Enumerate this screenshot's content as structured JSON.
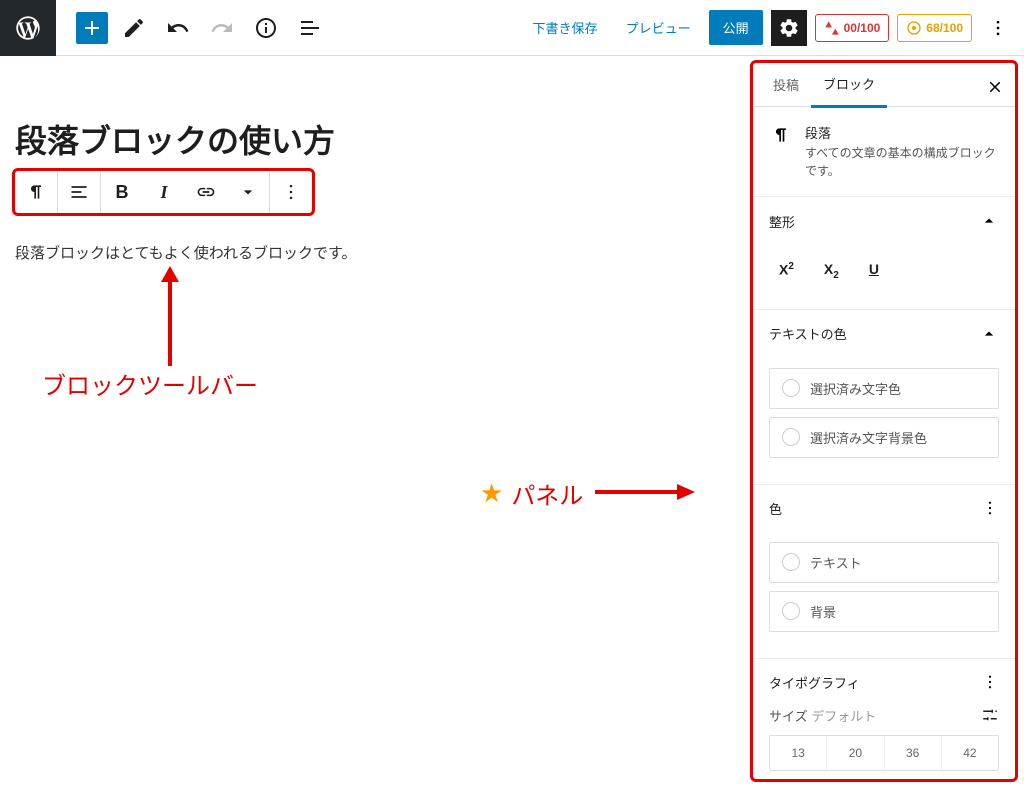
{
  "topbar": {
    "save_draft": "下書き保存",
    "preview": "プレビュー",
    "publish": "公開",
    "seo_score_1": "00/100",
    "seo_score_2": "68/100"
  },
  "editor": {
    "title": "段落ブロックの使い方",
    "paragraph": "段落ブロックはとてもよく使われるブロックです。"
  },
  "annotations": {
    "toolbar_label": "ブロックツールバー",
    "panel_label": "パネル"
  },
  "sidebar": {
    "tab_post": "投稿",
    "tab_block": "ブロック",
    "block_name": "段落",
    "block_desc": "すべての文章の基本の構成ブロックです。",
    "sections": {
      "formatting": "整形",
      "text_color": "テキストの色",
      "color": "色",
      "typography": "タイポグラフィ",
      "size": "サイズ",
      "size_default": "デフォルト"
    },
    "format_buttons": {
      "sup": "X",
      "sub": "X",
      "underline": "U"
    },
    "text_color_items": {
      "selected_text": "選択済み文字色",
      "selected_bg": "選択済み文字背景色"
    },
    "color_items": {
      "text": "テキスト",
      "bg": "背景"
    },
    "sizes": [
      "13",
      "20",
      "36",
      "42"
    ]
  }
}
